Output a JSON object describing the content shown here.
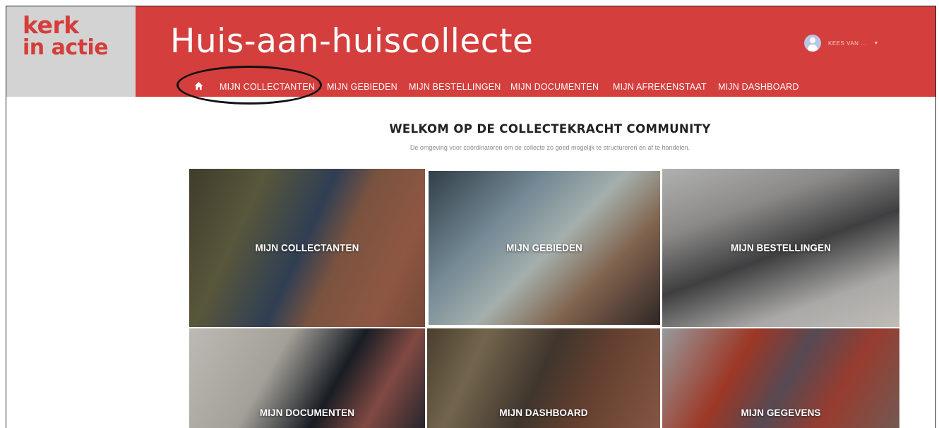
{
  "logo": {
    "line1": "kerk",
    "line2": "in actie"
  },
  "header": {
    "site_title": "Huis-aan-huiscollecte"
  },
  "user": {
    "name": "KEES VAN ...",
    "caret": "▼"
  },
  "nav": {
    "items": [
      {
        "label": "MIJN COLLECTANTEN"
      },
      {
        "label": "MIJN GEBIEDEN"
      },
      {
        "label": "MIJN BESTELLINGEN"
      },
      {
        "label": "MIJN DOCUMENTEN"
      },
      {
        "label": "MIJN AFREKENSTAAT"
      },
      {
        "label": "MIJN DASHBOARD"
      }
    ]
  },
  "main": {
    "title": "WELKOM OP DE COLLECTEKRACHT COMMUNITY",
    "subtitle": "De omgeving voor coördinatoren om de collecte zo goed mogelijk te structureren en af te handelen.",
    "tiles": [
      {
        "label": "MIJN COLLECTANTEN"
      },
      {
        "label": "MIJN GEBIEDEN"
      },
      {
        "label": "MIJN BESTELLINGEN"
      },
      {
        "label": "MIJN DOCUMENTEN"
      },
      {
        "label": "MIJN DASHBOARD"
      },
      {
        "label": "MIJN GEGEVENS"
      }
    ]
  },
  "colors": {
    "brand_red": "#d43e3c",
    "logo_bg": "#d3d3d3"
  }
}
